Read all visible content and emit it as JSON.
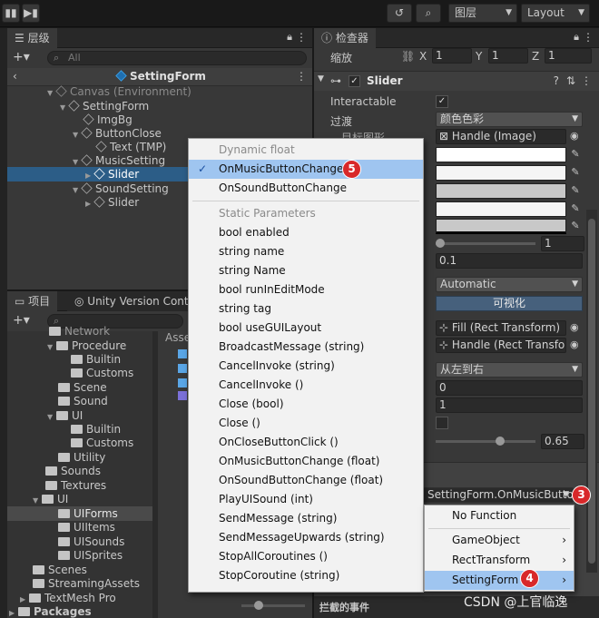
{
  "toolbar": {
    "history_icon": "history-icon",
    "search_icon": "search-icon",
    "layers": "图层",
    "layout": "Layout"
  },
  "hierarchy": {
    "tab": "层级",
    "search_placeholder": "All",
    "scene": "SettingForm",
    "items": [
      {
        "label": "Canvas (Environment)"
      },
      {
        "label": "SettingForm"
      },
      {
        "label": "ImgBg"
      },
      {
        "label": "ButtonClose"
      },
      {
        "label": "Text (TMP)"
      },
      {
        "label": "MusicSetting"
      },
      {
        "label": "Slider"
      },
      {
        "label": "SoundSetting"
      },
      {
        "label": "Slider"
      }
    ]
  },
  "project": {
    "tab1": "项目",
    "tab2": "Unity Version Control",
    "items": [
      {
        "label": "Network"
      },
      {
        "label": "Procedure"
      },
      {
        "label": "Builtin"
      },
      {
        "label": "Customs"
      },
      {
        "label": "Scene"
      },
      {
        "label": "Sound"
      },
      {
        "label": "UI"
      },
      {
        "label": "Builtin"
      },
      {
        "label": "Customs"
      },
      {
        "label": "Utility"
      },
      {
        "label": "Sounds"
      },
      {
        "label": "Textures"
      },
      {
        "label": "UI"
      },
      {
        "label": "UIForms"
      },
      {
        "label": "UIItems"
      },
      {
        "label": "UISounds"
      },
      {
        "label": "UISprites"
      },
      {
        "label": "Scenes"
      },
      {
        "label": "StreamingAssets"
      },
      {
        "label": "TextMesh Pro"
      },
      {
        "label": "Packages"
      }
    ],
    "assets_label": "Asse"
  },
  "inspector": {
    "tab": "检查器",
    "scale_label": "缩放",
    "scale": {
      "x_label": "X",
      "x": "1",
      "y_label": "Y",
      "y": "1",
      "z_label": "Z",
      "z": "1"
    },
    "component": "Slider",
    "interactable_label": "Interactable",
    "transition_label": "过渡",
    "transition_value": "颜色色彩",
    "target_graphic_label": "目标图形",
    "target_graphic_value": "Handle (Image)",
    "slider_value": "1",
    "fade_value": "0.1",
    "navigation_value": "Automatic",
    "visualize_label": "可视化",
    "fill_rect": "Fill (Rect Transform)",
    "handle_rect": "Handle (Rect Transform)",
    "direction": "从左到右",
    "min_value": "0",
    "max_value": "1",
    "value": "0.65",
    "event_target": "SettingForm.OnMusicButton",
    "intercept_label": "拦截的事件"
  },
  "function_menu": {
    "dynamic_header": "Dynamic float",
    "dynamic_items": [
      "OnMusicButtonChange",
      "OnSoundButtonChange"
    ],
    "static_header": "Static Parameters",
    "static_items": [
      "bool enabled",
      "string name",
      "string Name",
      "bool runInEditMode",
      "string tag",
      "bool useGUILayout",
      "BroadcastMessage (string)",
      "CancelInvoke (string)",
      "CancelInvoke ()",
      "Close (bool)",
      "Close ()",
      "OnCloseButtonClick ()",
      "OnMusicButtonChange (float)",
      "OnSoundButtonChange (float)",
      "PlayUISound (int)",
      "SendMessage (string)",
      "SendMessageUpwards (string)",
      "StopAllCoroutines ()",
      "StopCoroutine (string)"
    ]
  },
  "component_menu": {
    "items": [
      "No Function",
      "GameObject",
      "RectTransform",
      "SettingForm"
    ]
  },
  "badges": [
    "5",
    "3",
    "4"
  ],
  "watermark": "CSDN @上官临逸"
}
